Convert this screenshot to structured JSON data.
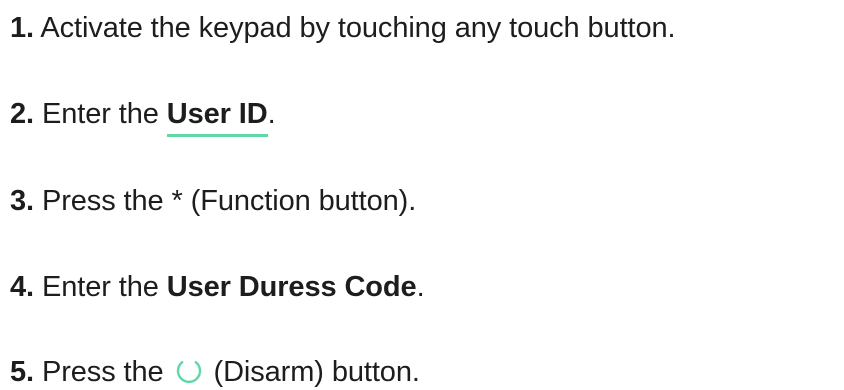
{
  "steps": [
    {
      "number": "1.",
      "text": "Activate the keypad by touching any touch button."
    },
    {
      "number": "2.",
      "before": "Enter the",
      "link": "User ID",
      "after": "."
    },
    {
      "number": "3.",
      "text": "Press the * (Function button)."
    },
    {
      "number": "4.",
      "before": "Enter the",
      "bold": "User Duress Code",
      "after": "."
    },
    {
      "number": "5.",
      "before": "Press the",
      "icon": "disarm-icon",
      "after": "(Disarm) button."
    }
  ],
  "colors": {
    "text": "#1d1d1f",
    "accent": "#5ed8a4"
  }
}
